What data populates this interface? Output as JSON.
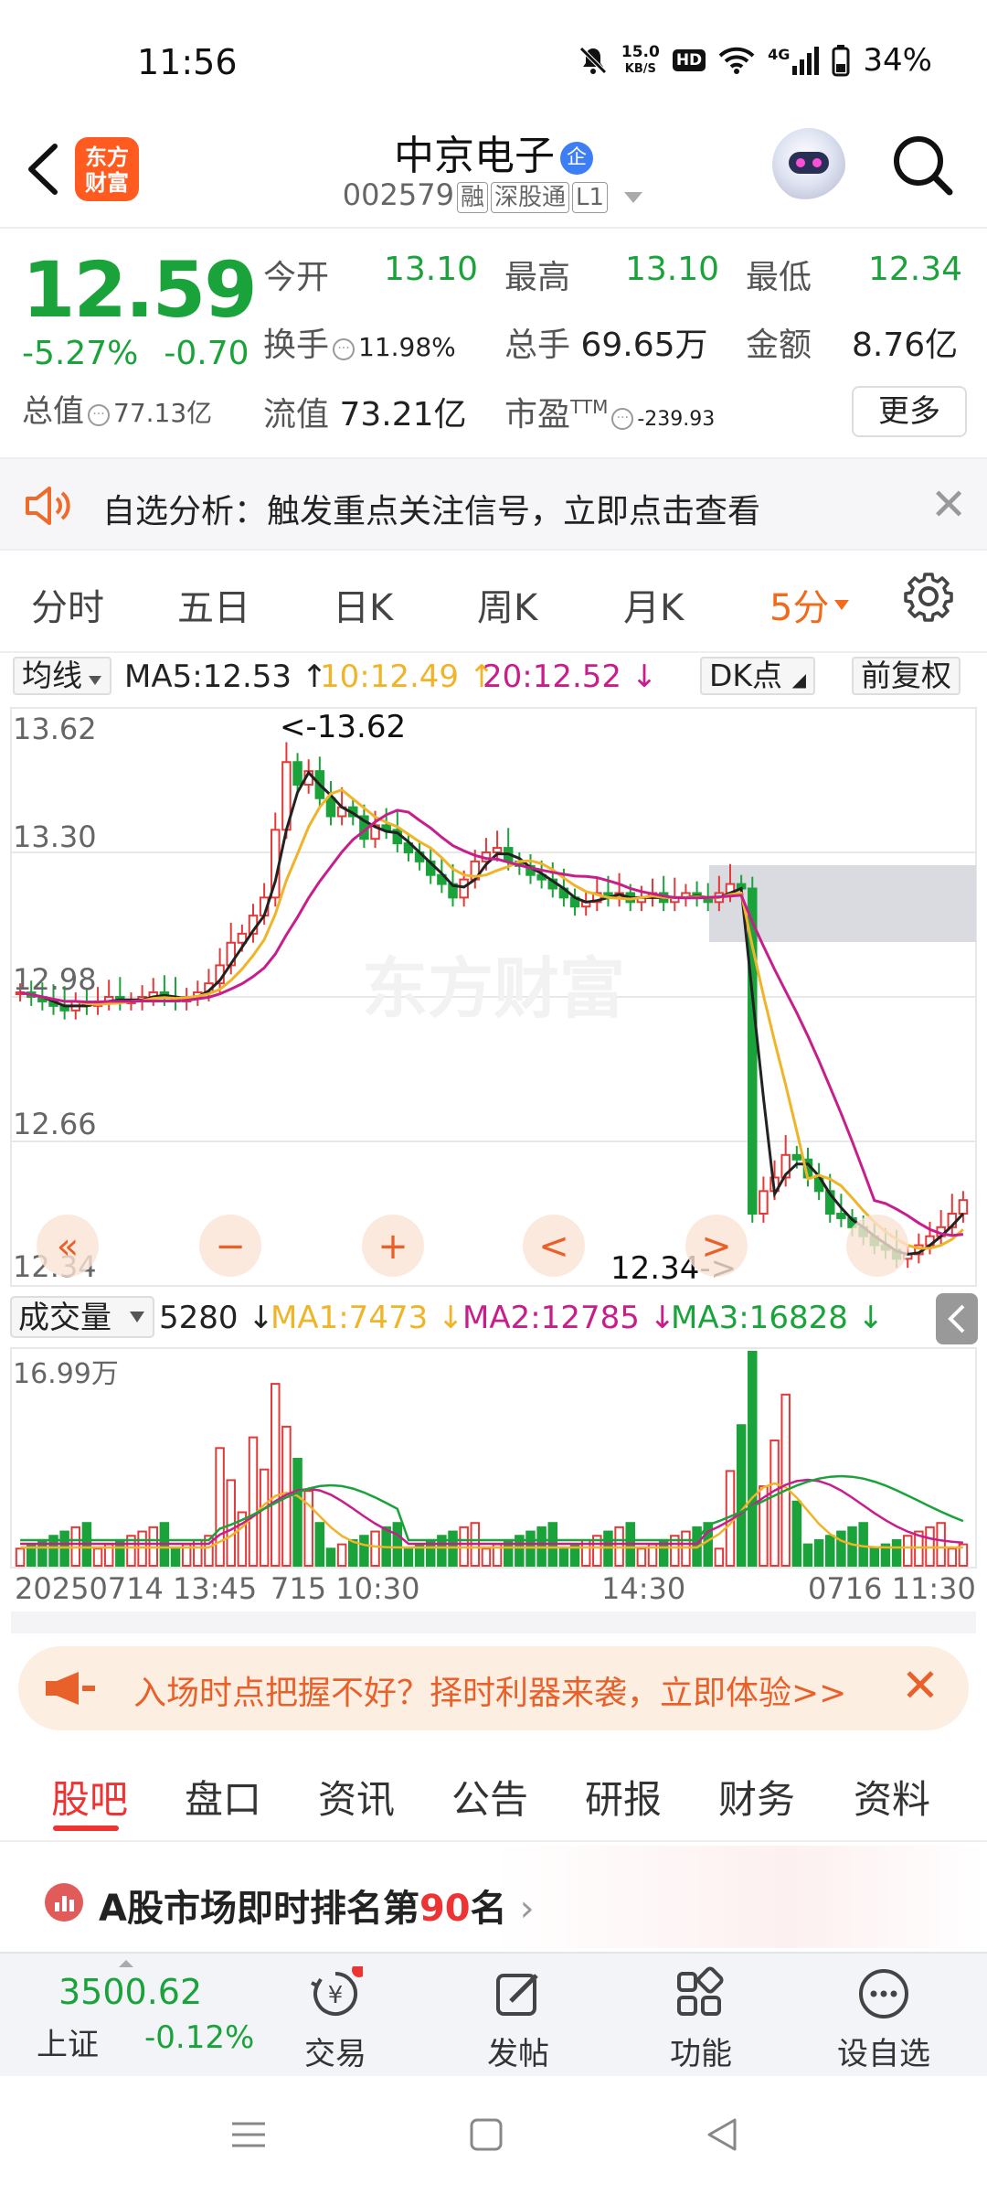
{
  "status_bar": {
    "time": "11:56",
    "net_speed_value": "15.0",
    "net_speed_unit": "KB/S",
    "hd": "HD",
    "network": "4G",
    "battery": "34%"
  },
  "header": {
    "logo_line1": "东方",
    "logo_line2": "财富",
    "title": "中京电子",
    "title_badge": "企",
    "code": "002579",
    "tags": [
      "融",
      "深股通",
      "L1"
    ]
  },
  "quote": {
    "price": "12.59",
    "change_pct": "-5.27%",
    "change": "-0.70",
    "open_label": "今开",
    "open": "13.10",
    "high_label": "最高",
    "high": "13.10",
    "low_label": "最低",
    "low": "12.34",
    "turnover_label": "换手",
    "turnover": "11.98%",
    "volume_label": "总手",
    "volume": "69.65万",
    "amount_label": "金额",
    "amount": "8.76亿",
    "total_value_label": "总值",
    "total_value": "77.13亿",
    "float_value_label": "流值",
    "float_value": "73.21亿",
    "pe_label": "市盈",
    "pe_sup": "TTM",
    "pe": "-239.93",
    "more_label": "更多"
  },
  "notice": {
    "text": "自选分析：触发重点关注信号，立即点击查看"
  },
  "chart_tabs": {
    "items": [
      "分时",
      "五日",
      "日K",
      "周K",
      "月K",
      "5分"
    ],
    "active": "5分"
  },
  "ma_bar": {
    "selector": "均线",
    "ma5": "MA5:12.53",
    "ma10": "10:12.49",
    "ma20": "20:12.52",
    "dk": "DK点",
    "adjust": "前复权",
    "colors": {
      "ma5": "#222222",
      "ma10": "#f0b429",
      "ma20": "#c81e8c"
    }
  },
  "chart": {
    "y_labels": [
      "13.62",
      "13.30",
      "12.98",
      "12.66",
      "12.34"
    ],
    "high_marker": "<-13.62",
    "low_marker": "12.34->",
    "watermark": "东方财富",
    "colors": {
      "up": "#e03a3a",
      "down": "#1aa33a",
      "zone": "#d9dbe0"
    }
  },
  "volume_bar": {
    "selector": "成交量",
    "value": "5280",
    "ma1": "MA1:7473",
    "ma2": "MA2:12785",
    "ma3": "MA3:16828",
    "max_label": "16.99万",
    "x_labels": [
      "20250714 13:45",
      "715 10:30",
      "14:30",
      "0716 11:30"
    ]
  },
  "chart_controls": {
    "items": [
      "«",
      "−",
      "+",
      "<",
      ">"
    ]
  },
  "banner": {
    "text": "入场时点把握不好？择时利器来袭，立即体验>>"
  },
  "news_tabs": {
    "items": [
      "股吧",
      "盘口",
      "资讯",
      "公告",
      "研报",
      "财务",
      "资料"
    ],
    "active": "股吧"
  },
  "rank": {
    "prefix": "A股市场即时排名第",
    "number": "90",
    "suffix": "名"
  },
  "bottom_nav": {
    "index_value": "3500.62",
    "index_name": "上证",
    "index_change": "-0.12%",
    "items": [
      "交易",
      "发帖",
      "功能",
      "设自选"
    ]
  }
}
